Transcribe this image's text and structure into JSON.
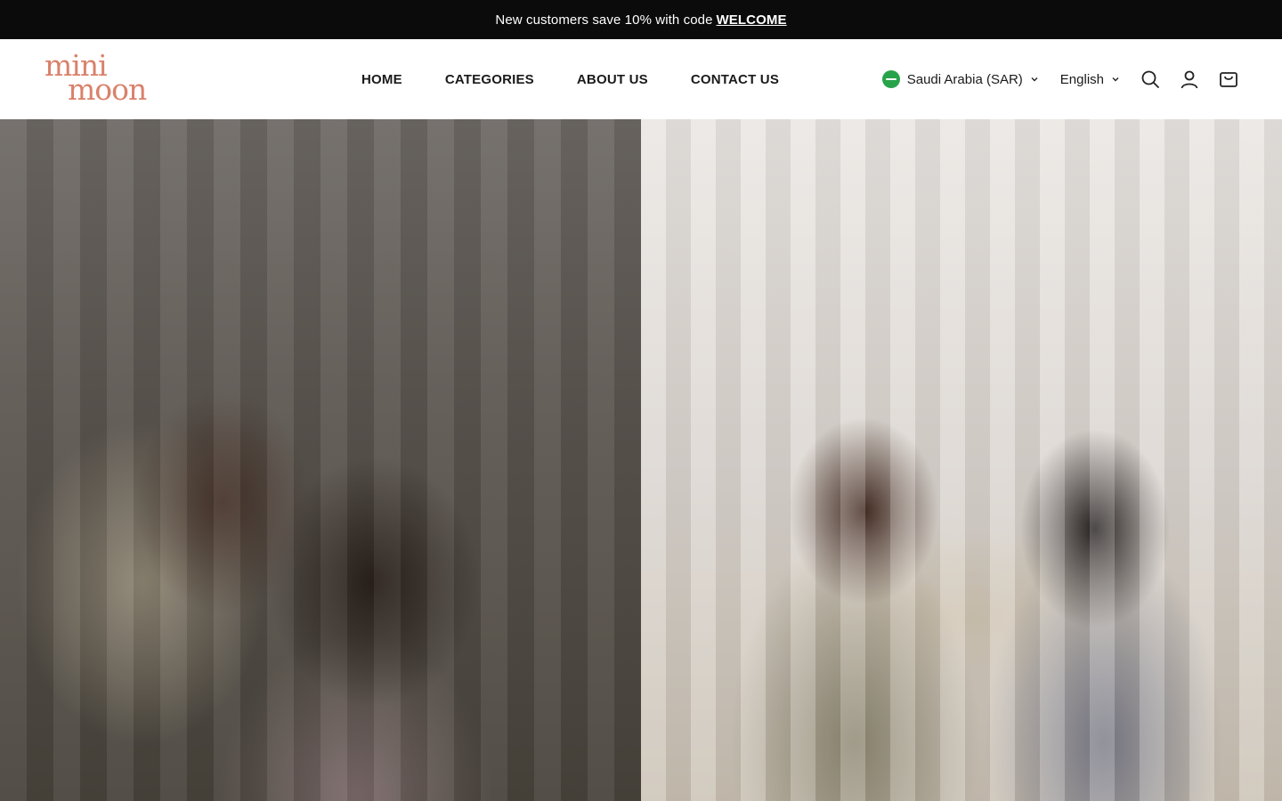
{
  "announcement": {
    "text": "New customers save 10% with code",
    "code": "WELCOME"
  },
  "header": {
    "logo_line1": "mini",
    "logo_line2": "moon",
    "brand_color": "#d9826b",
    "nav": [
      {
        "label": "HOME"
      },
      {
        "label": "CATEGORIES"
      },
      {
        "label": "ABOUT US"
      },
      {
        "label": "CONTACT US"
      }
    ],
    "country": {
      "label": "Saudi Arabia (SAR)",
      "flag_icon": "saudi-flag-icon"
    },
    "language": {
      "label": "English"
    },
    "icons": [
      "search-icon",
      "account-icon",
      "cart-icon"
    ]
  },
  "hero": {
    "panels": [
      {
        "name": "hero-image-left",
        "description_icon": "lifestyle-photo"
      },
      {
        "name": "hero-image-right",
        "description_icon": "lifestyle-photo"
      }
    ]
  }
}
